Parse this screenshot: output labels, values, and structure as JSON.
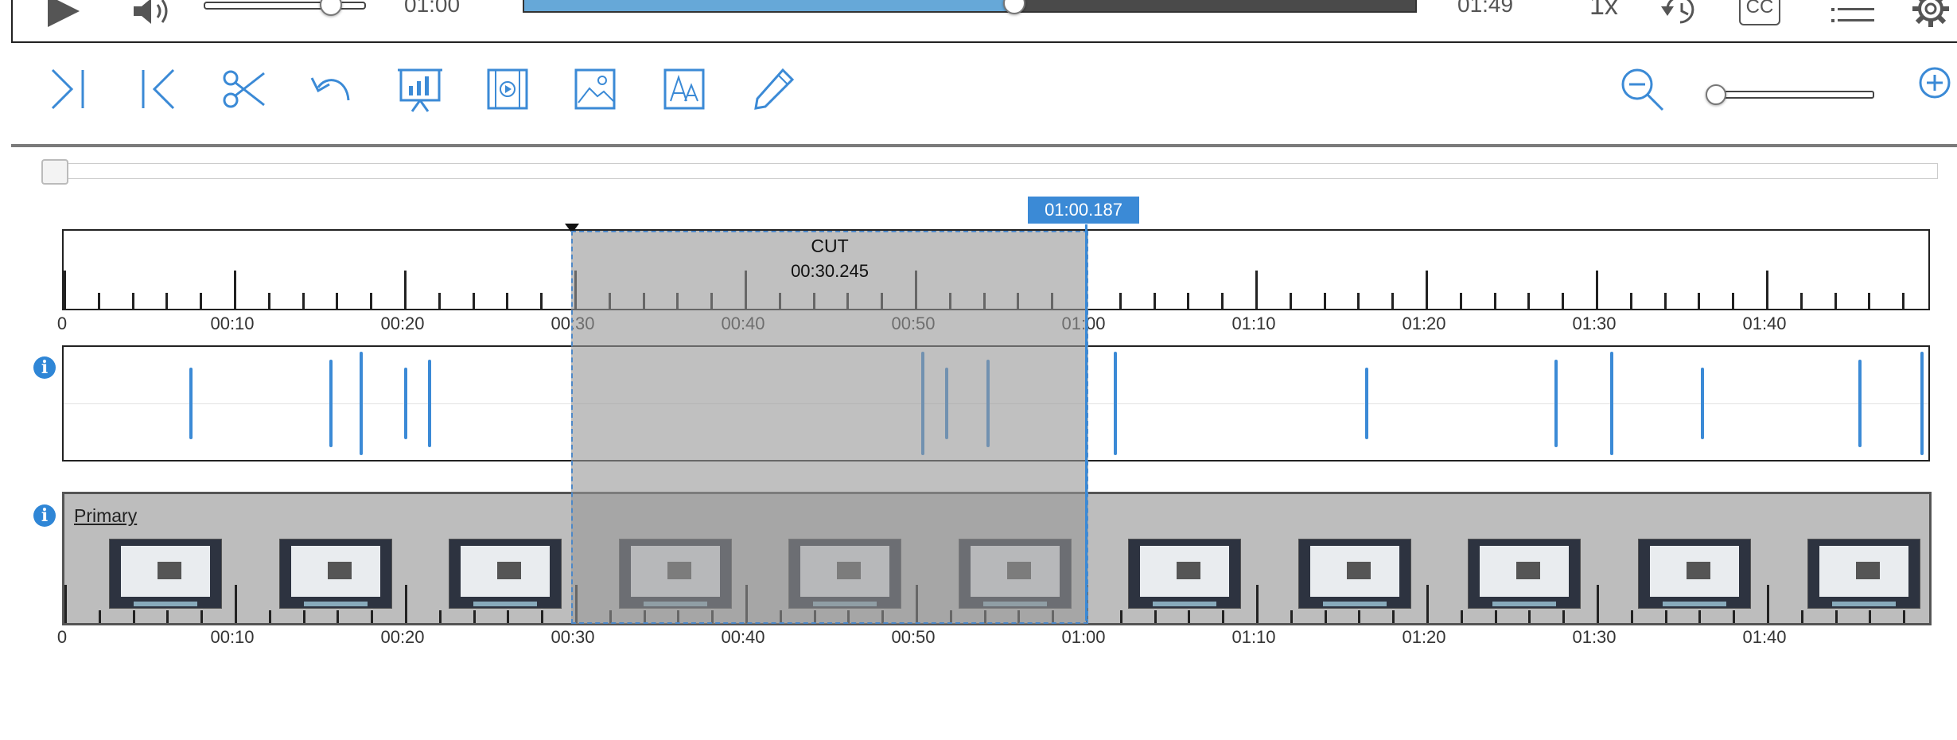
{
  "player": {
    "current_time": "01:00",
    "duration": "01:49",
    "speed": "1x",
    "cc_label": "CC",
    "progress_fraction": 0.55,
    "volume_fraction": 0.72
  },
  "toolbar": {
    "tools": [
      "skip-to-end-icon",
      "skip-to-start-icon",
      "cut-icon",
      "undo-icon",
      "chart-slide-icon",
      "video-clip-icon",
      "image-icon",
      "text-font-icon",
      "pencil-icon"
    ],
    "zoom_fraction": 0.0
  },
  "timeline": {
    "ruler_labels": [
      "0",
      "00:10",
      "00:20",
      "00:30",
      "00:40",
      "00:50",
      "01:00",
      "01:10",
      "01:20",
      "01:30",
      "01:40"
    ],
    "bottom_labels": [
      "0",
      "00:10",
      "00:20",
      "00:30",
      "00:40",
      "00:50",
      "01:00",
      "01:10",
      "01:20",
      "01:30",
      "01:40"
    ],
    "cut_label": "CUT",
    "cut_duration": "00:30.245",
    "playhead_time": "01:00.187",
    "track_name": "Primary"
  },
  "colors": {
    "accent": "#3b8ad6",
    "progress_fill": "#66a8d8"
  }
}
